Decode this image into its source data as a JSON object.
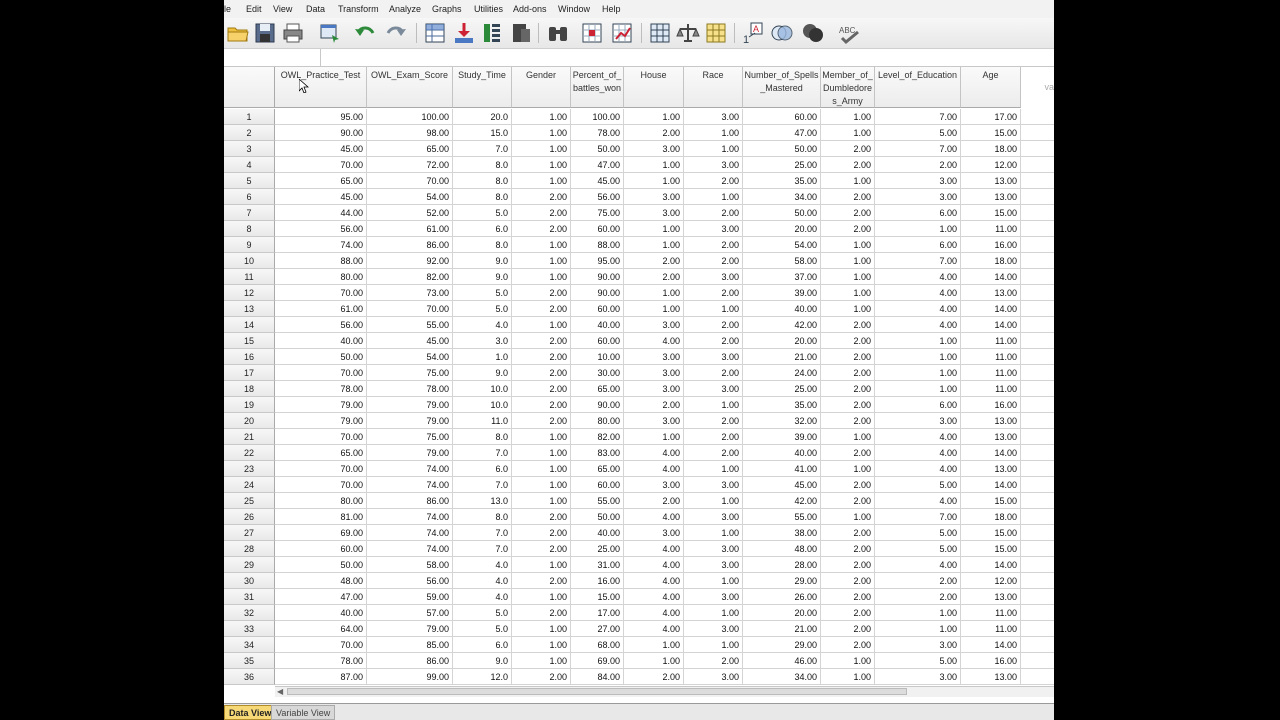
{
  "menu": [
    "le",
    "Edit",
    "View",
    "Data",
    "Transform",
    "Analyze",
    "Graphs",
    "Utilities",
    "Add-ons",
    "Window",
    "Help"
  ],
  "toolbar_icons": [
    "open-icon",
    "save-icon",
    "print-icon",
    "dialog-recall-icon",
    "undo-icon",
    "redo-icon",
    "goto-case-icon",
    "goto-variable-icon",
    "variables-icon",
    "run-descriptives-icon",
    "find-icon",
    "insert-cases-icon",
    "insert-variable-icon",
    "split-file-icon",
    "weight-cases-icon",
    "select-cases-icon",
    "value-labels-icon",
    "use-sets-icon",
    "show-all-variables-icon",
    "spelling-icon"
  ],
  "columns": [
    "OWL_Practice_Test",
    "OWL_Exam_Score",
    "Study_Time",
    "Gender",
    "Percent_of_\nbattles_won",
    "House",
    "Race",
    "Number_of_Spells\n_Mastered",
    "Member_of_\nDumbledore\ns_Army",
    "Level_of_Education",
    "Age",
    "va"
  ],
  "rows": [
    [
      "1",
      "95.00",
      "100.00",
      "20.0",
      "1.00",
      "100.00",
      "1.00",
      "3.00",
      "60.00",
      "1.00",
      "7.00",
      "17.00"
    ],
    [
      "2",
      "90.00",
      "98.00",
      "15.0",
      "1.00",
      "78.00",
      "2.00",
      "1.00",
      "47.00",
      "1.00",
      "5.00",
      "15.00"
    ],
    [
      "3",
      "45.00",
      "65.00",
      "7.0",
      "1.00",
      "50.00",
      "3.00",
      "1.00",
      "50.00",
      "2.00",
      "7.00",
      "18.00"
    ],
    [
      "4",
      "70.00",
      "72.00",
      "8.0",
      "1.00",
      "47.00",
      "1.00",
      "3.00",
      "25.00",
      "2.00",
      "2.00",
      "12.00"
    ],
    [
      "5",
      "65.00",
      "70.00",
      "8.0",
      "1.00",
      "45.00",
      "1.00",
      "2.00",
      "35.00",
      "1.00",
      "3.00",
      "13.00"
    ],
    [
      "6",
      "45.00",
      "54.00",
      "8.0",
      "2.00",
      "56.00",
      "3.00",
      "1.00",
      "34.00",
      "2.00",
      "3.00",
      "13.00"
    ],
    [
      "7",
      "44.00",
      "52.00",
      "5.0",
      "2.00",
      "75.00",
      "3.00",
      "2.00",
      "50.00",
      "2.00",
      "6.00",
      "15.00"
    ],
    [
      "8",
      "56.00",
      "61.00",
      "6.0",
      "2.00",
      "60.00",
      "1.00",
      "3.00",
      "20.00",
      "2.00",
      "1.00",
      "11.00"
    ],
    [
      "9",
      "74.00",
      "86.00",
      "8.0",
      "1.00",
      "88.00",
      "1.00",
      "2.00",
      "54.00",
      "1.00",
      "6.00",
      "16.00"
    ],
    [
      "10",
      "88.00",
      "92.00",
      "9.0",
      "1.00",
      "95.00",
      "2.00",
      "2.00",
      "58.00",
      "1.00",
      "7.00",
      "18.00"
    ],
    [
      "11",
      "80.00",
      "82.00",
      "9.0",
      "1.00",
      "90.00",
      "2.00",
      "3.00",
      "37.00",
      "1.00",
      "4.00",
      "14.00"
    ],
    [
      "12",
      "70.00",
      "73.00",
      "5.0",
      "2.00",
      "90.00",
      "1.00",
      "2.00",
      "39.00",
      "1.00",
      "4.00",
      "13.00"
    ],
    [
      "13",
      "61.00",
      "70.00",
      "5.0",
      "2.00",
      "60.00",
      "1.00",
      "1.00",
      "40.00",
      "1.00",
      "4.00",
      "14.00"
    ],
    [
      "14",
      "56.00",
      "55.00",
      "4.0",
      "1.00",
      "40.00",
      "3.00",
      "2.00",
      "42.00",
      "2.00",
      "4.00",
      "14.00"
    ],
    [
      "15",
      "40.00",
      "45.00",
      "3.0",
      "2.00",
      "60.00",
      "4.00",
      "2.00",
      "20.00",
      "2.00",
      "1.00",
      "11.00"
    ],
    [
      "16",
      "50.00",
      "54.00",
      "1.0",
      "2.00",
      "10.00",
      "3.00",
      "3.00",
      "21.00",
      "2.00",
      "1.00",
      "11.00"
    ],
    [
      "17",
      "70.00",
      "75.00",
      "9.0",
      "2.00",
      "30.00",
      "3.00",
      "2.00",
      "24.00",
      "2.00",
      "1.00",
      "11.00"
    ],
    [
      "18",
      "78.00",
      "78.00",
      "10.0",
      "2.00",
      "65.00",
      "3.00",
      "3.00",
      "25.00",
      "2.00",
      "1.00",
      "11.00"
    ],
    [
      "19",
      "79.00",
      "79.00",
      "10.0",
      "2.00",
      "90.00",
      "2.00",
      "1.00",
      "35.00",
      "2.00",
      "6.00",
      "16.00"
    ],
    [
      "20",
      "79.00",
      "79.00",
      "11.0",
      "2.00",
      "80.00",
      "3.00",
      "2.00",
      "32.00",
      "2.00",
      "3.00",
      "13.00"
    ],
    [
      "21",
      "70.00",
      "75.00",
      "8.0",
      "1.00",
      "82.00",
      "1.00",
      "2.00",
      "39.00",
      "1.00",
      "4.00",
      "13.00"
    ],
    [
      "22",
      "65.00",
      "79.00",
      "7.0",
      "1.00",
      "83.00",
      "4.00",
      "2.00",
      "40.00",
      "2.00",
      "4.00",
      "14.00"
    ],
    [
      "23",
      "70.00",
      "74.00",
      "6.0",
      "1.00",
      "65.00",
      "4.00",
      "1.00",
      "41.00",
      "1.00",
      "4.00",
      "13.00"
    ],
    [
      "24",
      "70.00",
      "74.00",
      "7.0",
      "1.00",
      "60.00",
      "3.00",
      "3.00",
      "45.00",
      "2.00",
      "5.00",
      "14.00"
    ],
    [
      "25",
      "80.00",
      "86.00",
      "13.0",
      "1.00",
      "55.00",
      "2.00",
      "1.00",
      "42.00",
      "2.00",
      "4.00",
      "15.00"
    ],
    [
      "26",
      "81.00",
      "74.00",
      "8.0",
      "2.00",
      "50.00",
      "4.00",
      "3.00",
      "55.00",
      "1.00",
      "7.00",
      "18.00"
    ],
    [
      "27",
      "69.00",
      "74.00",
      "7.0",
      "2.00",
      "40.00",
      "3.00",
      "1.00",
      "38.00",
      "2.00",
      "5.00",
      "15.00"
    ],
    [
      "28",
      "60.00",
      "74.00",
      "7.0",
      "2.00",
      "25.00",
      "4.00",
      "3.00",
      "48.00",
      "2.00",
      "5.00",
      "15.00"
    ],
    [
      "29",
      "50.00",
      "58.00",
      "4.0",
      "1.00",
      "31.00",
      "4.00",
      "3.00",
      "28.00",
      "2.00",
      "4.00",
      "14.00"
    ],
    [
      "30",
      "48.00",
      "56.00",
      "4.0",
      "2.00",
      "16.00",
      "4.00",
      "1.00",
      "29.00",
      "2.00",
      "2.00",
      "12.00"
    ],
    [
      "31",
      "47.00",
      "59.00",
      "4.0",
      "1.00",
      "15.00",
      "4.00",
      "3.00",
      "26.00",
      "2.00",
      "2.00",
      "13.00"
    ],
    [
      "32",
      "40.00",
      "57.00",
      "5.0",
      "2.00",
      "17.00",
      "4.00",
      "1.00",
      "20.00",
      "2.00",
      "1.00",
      "11.00"
    ],
    [
      "33",
      "64.00",
      "79.00",
      "5.0",
      "1.00",
      "27.00",
      "4.00",
      "3.00",
      "21.00",
      "2.00",
      "1.00",
      "11.00"
    ],
    [
      "34",
      "70.00",
      "85.00",
      "6.0",
      "1.00",
      "68.00",
      "1.00",
      "1.00",
      "29.00",
      "2.00",
      "3.00",
      "14.00"
    ],
    [
      "35",
      "78.00",
      "86.00",
      "9.0",
      "1.00",
      "69.00",
      "1.00",
      "2.00",
      "46.00",
      "1.00",
      "5.00",
      "16.00"
    ],
    [
      "36",
      "87.00",
      "99.00",
      "12.0",
      "2.00",
      "84.00",
      "2.00",
      "3.00",
      "34.00",
      "1.00",
      "3.00",
      "13.00"
    ]
  ],
  "tabs": {
    "data_view": "Data View",
    "variable_view": "Variable View"
  },
  "colors": {
    "active_tab": "#f7d877",
    "background": "#000000"
  }
}
